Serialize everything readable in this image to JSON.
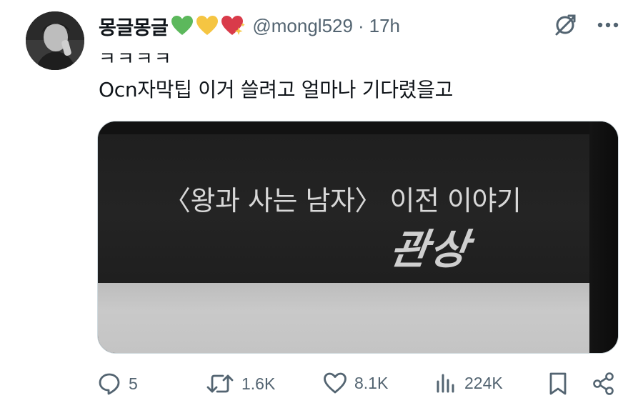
{
  "tweet": {
    "display_name": "몽글몽글",
    "emoji_icons": [
      "green-heart-icon",
      "yellow-heart-icon",
      "sparkling-heart-icon"
    ],
    "handle": "@mongl529",
    "separator": "·",
    "timestamp": "17h",
    "text_line_1": "ㅋㅋㅋㅋ",
    "text_line_2": "Ocn자막팁 이거 쓸려고 얼마나 기다렸을고",
    "media": {
      "subtitle": "〈왕과 사는 남자〉 이전 이야기",
      "title": "관상"
    },
    "actions": {
      "replies": "5",
      "retweets": "1.6K",
      "likes": "8.1K",
      "views": "224K"
    }
  },
  "colors": {
    "text": "#0f1419",
    "secondary": "#536471",
    "green_heart": "#5cb85c",
    "yellow_heart": "#f5c542",
    "red_heart": "#d93b4a"
  }
}
